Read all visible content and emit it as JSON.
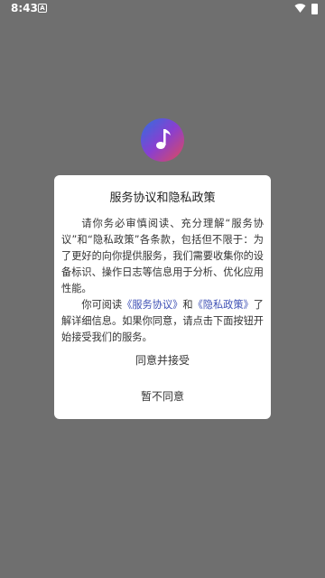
{
  "status_bar": {
    "time": "8:43",
    "notification_glyph": "A",
    "icons": [
      "wifi-icon",
      "battery-icon"
    ]
  },
  "dialog": {
    "title": "服务协议和隐私政策",
    "paragraph1": "请你务必审慎阅读、充分理解“服务协议”和“隐私政策”各条款，包括但不限于：为了更好的向你提供服务，我们需要收集你的设备标识、操作日志等信息用于分析、优化应用性能。",
    "paragraph2_prefix": "你可阅读",
    "service_link": "《服务协议》",
    "and_text": "和",
    "privacy_link": "《隐私政策》",
    "paragraph2_suffix": "了解详细信息。如果你同意，请点击下面按钮开始接受我们的服务。",
    "agree_label": "同意并接受",
    "disagree_label": "暂不同意"
  },
  "colors": {
    "overlay": "#6f6f6f",
    "link": "#3f51b5",
    "dialog_bg": "#ffffff"
  }
}
